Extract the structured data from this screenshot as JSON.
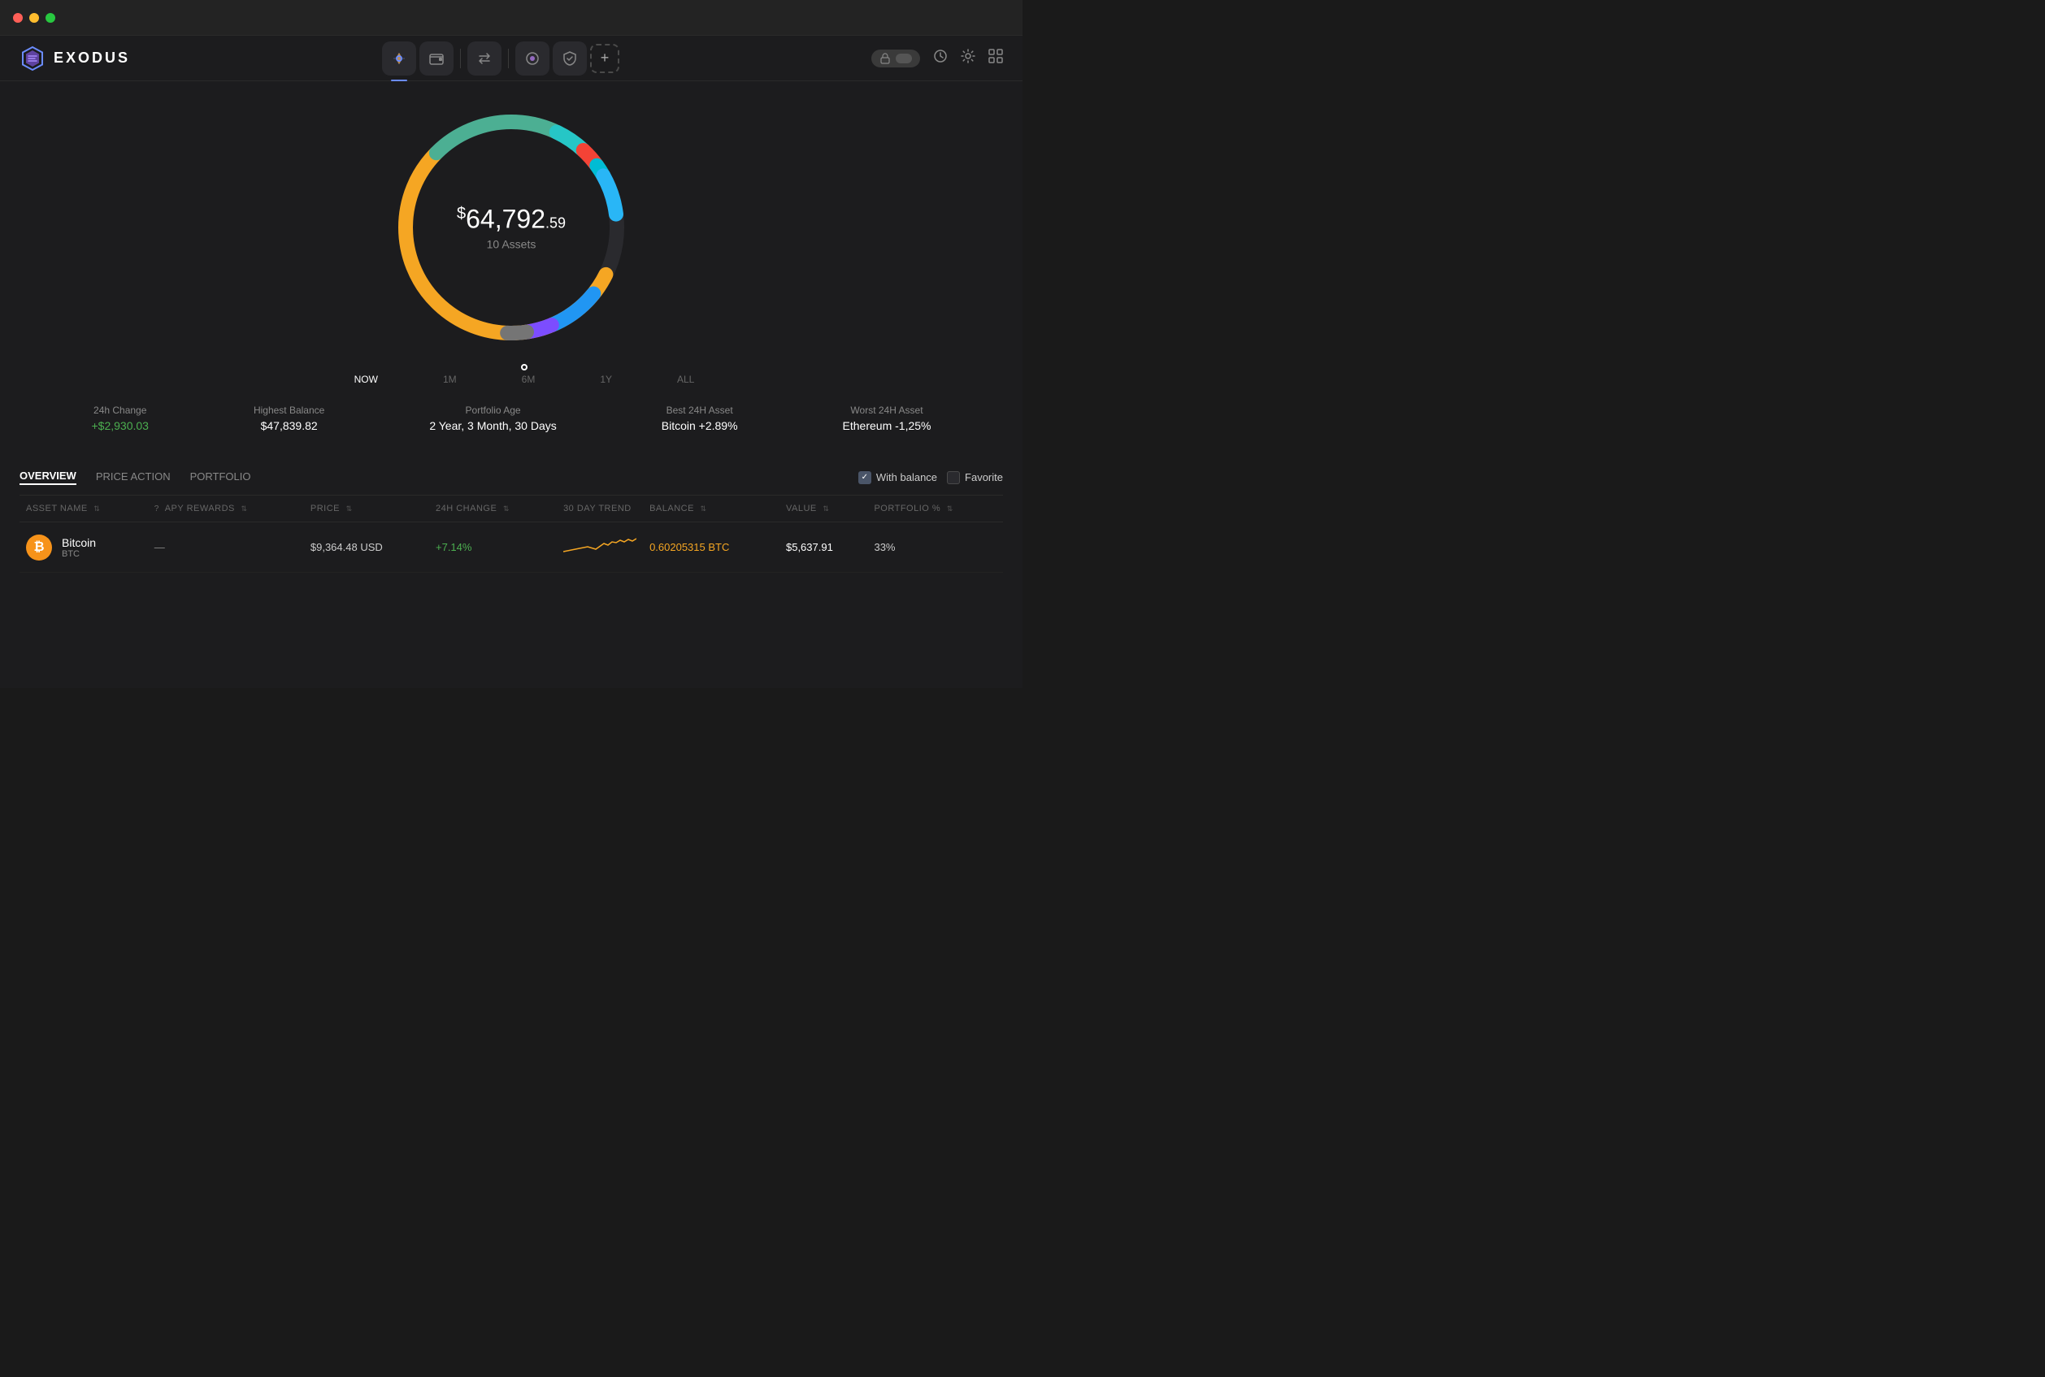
{
  "titlebar": {
    "traffic_lights": [
      "red",
      "yellow",
      "green"
    ]
  },
  "logo": {
    "text": "EXODUS"
  },
  "nav": {
    "center_items": [
      {
        "id": "portfolio",
        "label": "Portfolio",
        "active": true
      },
      {
        "id": "wallet",
        "label": "Wallet"
      },
      {
        "id": "exchange",
        "label": "Exchange"
      },
      {
        "id": "nifty",
        "label": "Nifty"
      },
      {
        "id": "earn",
        "label": "Earn"
      },
      {
        "id": "add",
        "label": "+"
      }
    ],
    "right_items": [
      {
        "id": "lock",
        "label": "Lock"
      },
      {
        "id": "history",
        "label": "History"
      },
      {
        "id": "settings-gear",
        "label": "Settings"
      },
      {
        "id": "grid",
        "label": "Apps"
      }
    ]
  },
  "portfolio": {
    "amount_currency": "$",
    "amount_main": "64,792",
    "amount_cents": ".59",
    "assets_count": "10 Assets",
    "timeline": {
      "items": [
        {
          "label": "NOW",
          "active": true
        },
        {
          "label": "1M",
          "active": false
        },
        {
          "label": "6M",
          "active": false
        },
        {
          "label": "1Y",
          "active": false
        },
        {
          "label": "ALL",
          "active": false
        }
      ]
    }
  },
  "stats": [
    {
      "label": "24h Change",
      "value": "+$2,930.03",
      "type": "positive"
    },
    {
      "label": "Highest Balance",
      "value": "$47,839.82",
      "type": "neutral"
    },
    {
      "label": "Portfolio Age",
      "value": "2 Year, 3 Month, 30 Days",
      "type": "neutral"
    },
    {
      "label": "Best 24H Asset",
      "value": "Bitcoin +2.89%",
      "type": "neutral"
    },
    {
      "label": "Worst 24H Asset",
      "value": "Ethereum -1,25%",
      "type": "neutral"
    }
  ],
  "table": {
    "tabs": [
      {
        "label": "OVERVIEW",
        "active": true
      },
      {
        "label": "PRICE ACTION",
        "active": false
      },
      {
        "label": "PORTFOLIO",
        "active": false
      }
    ],
    "filters": [
      {
        "label": "With balance",
        "checked": true
      },
      {
        "label": "Favorite",
        "checked": false
      }
    ],
    "columns": [
      {
        "label": "ASSET NAME",
        "sortable": true
      },
      {
        "label": "APY REWARDS",
        "sortable": true,
        "has_help": true
      },
      {
        "label": "PRICE",
        "sortable": true
      },
      {
        "label": "24H CHANGE",
        "sortable": true
      },
      {
        "label": "30 DAY TREND",
        "sortable": false
      },
      {
        "label": "BALANCE",
        "sortable": true
      },
      {
        "label": "VALUE",
        "sortable": true
      },
      {
        "label": "PORTFOLIO %",
        "sortable": true
      }
    ],
    "rows": [
      {
        "name": "Bitcoin",
        "ticker": "BTC",
        "icon_bg": "#f7931a",
        "icon_text": "₿",
        "apy": "",
        "price": "$9,364.48 USD",
        "change": "+7.14%",
        "change_type": "positive",
        "balance": "0.60205315 BTC",
        "value": "$5,637.91",
        "portfolio": "33%"
      }
    ]
  }
}
